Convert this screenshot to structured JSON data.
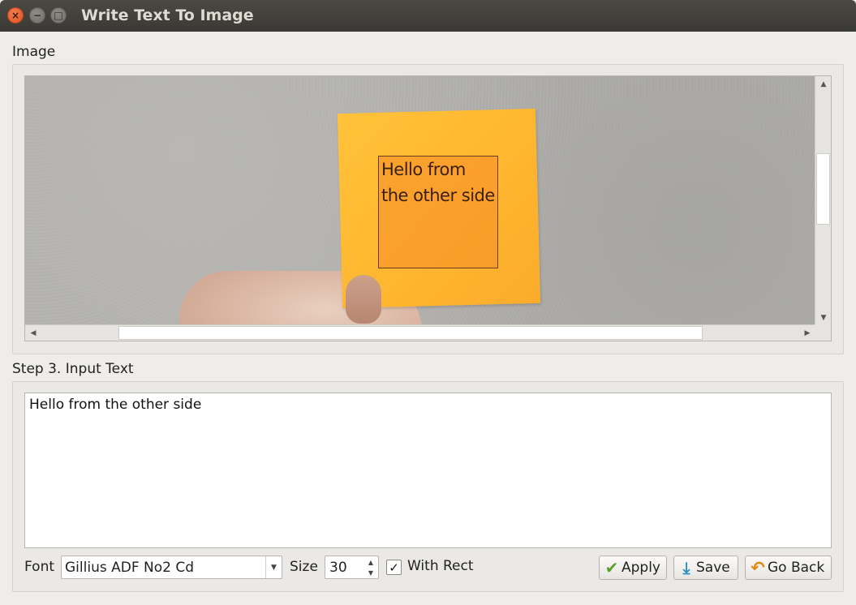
{
  "window": {
    "title": "Write Text To Image",
    "close_glyph": "×",
    "min_glyph": "−",
    "max_glyph": "□"
  },
  "image_section": {
    "label": "Image",
    "overlay_text": "Hello from the other side",
    "scroll_up": "▲",
    "scroll_down": "▼",
    "scroll_left": "◀",
    "scroll_right": "▶"
  },
  "input_section": {
    "label": "Step 3. Input Text",
    "text": "Hello from the other side"
  },
  "controls": {
    "font_label": "Font",
    "font_value": "Gillius ADF No2 Cd",
    "font_dropdown_glyph": "▼",
    "size_label": "Size",
    "size_value": "30",
    "spin_up": "▲",
    "spin_down": "▼",
    "with_rect_label": "With Rect",
    "with_rect_checked": true,
    "check_glyph": "✓"
  },
  "buttons": {
    "apply": {
      "label": "Apply",
      "icon": "checkmark-icon",
      "glyph": "✔",
      "color": "#5aa02c"
    },
    "save": {
      "label": "Save",
      "icon": "download-icon",
      "glyph": "⤓",
      "color": "#2a8fbf"
    },
    "go_back": {
      "label": "Go Back",
      "icon": "undo-icon",
      "glyph": "↶",
      "color": "#e08a10"
    }
  }
}
